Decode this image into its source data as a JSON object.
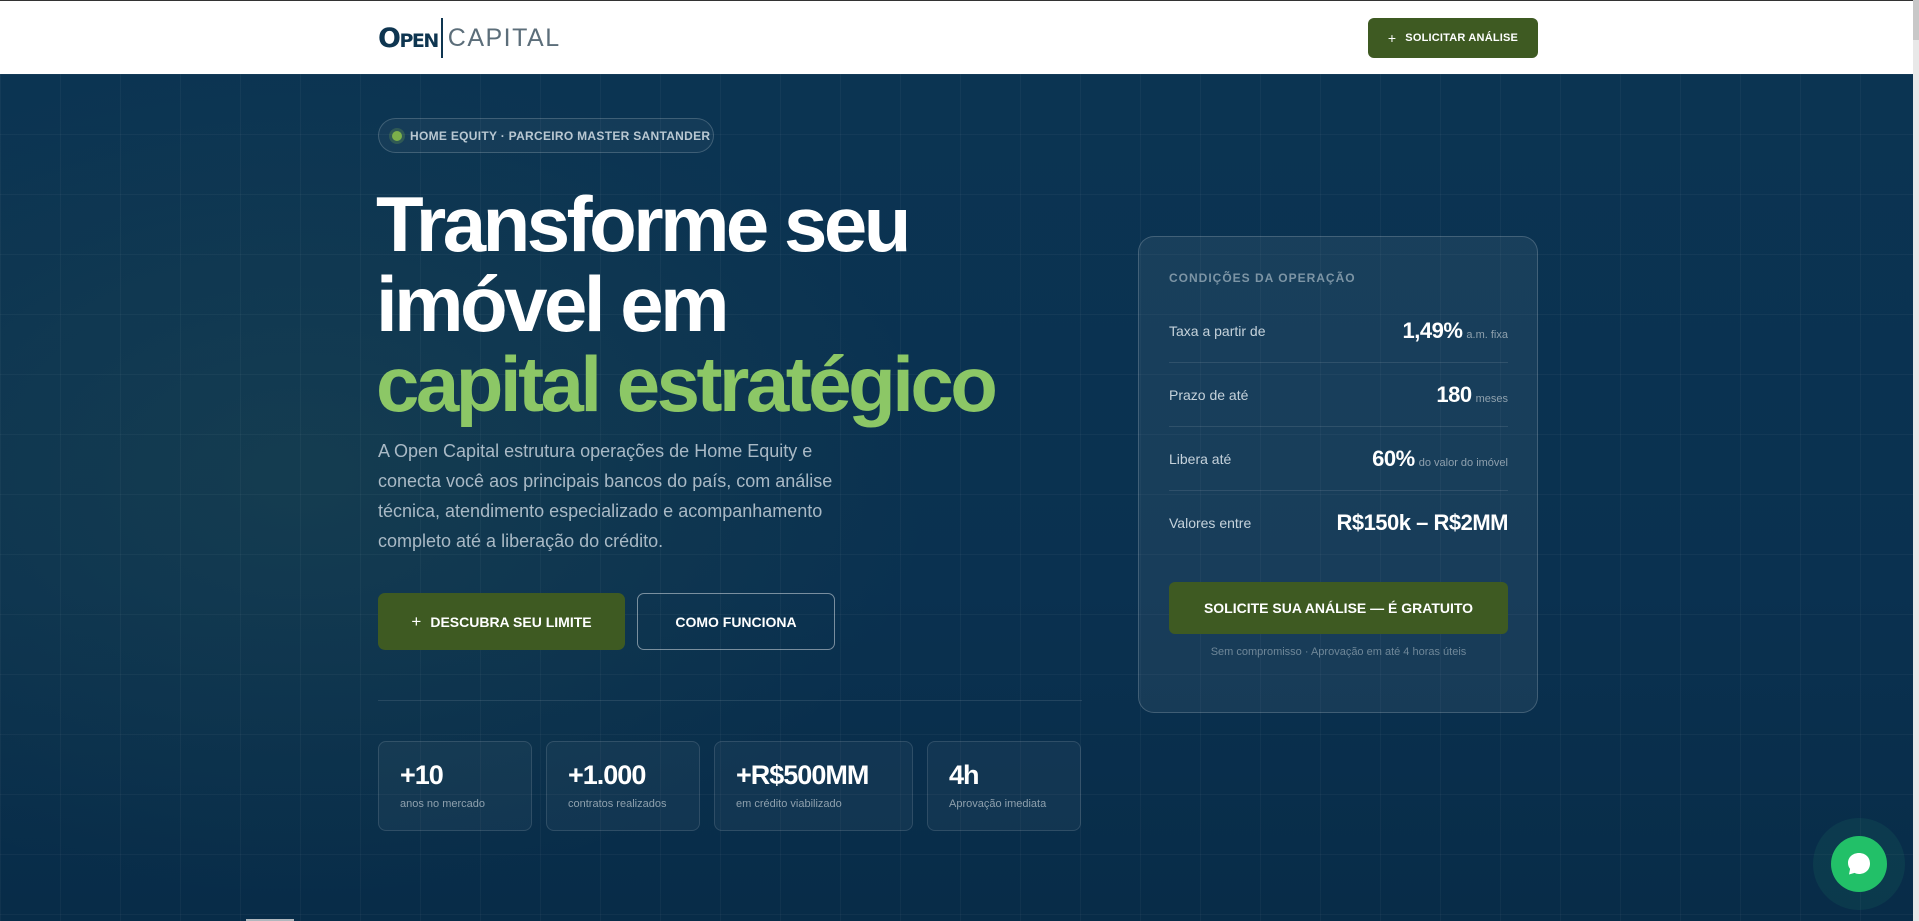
{
  "header": {
    "logo_open": "Open",
    "logo_capital": "CAPITAL",
    "cta_icon": "plus-icon",
    "cta_label": "SOLICITAR ANÁLISE"
  },
  "hero": {
    "badge": "HOME EQUITY · PARCEIRO MASTER SANTANDER",
    "title_line1": "Transforme seu",
    "title_line2": "imóvel em",
    "title_line3": "capital estratégico",
    "description": "A Open Capital estrutura operações de Home Equity e conecta você aos principais bancos do país, com análise técnica, atendimento especializado e acompanhamento completo até a liberação do crédito.",
    "primary_button": "DESCUBRA SEU LIMITE",
    "secondary_button": "COMO FUNCIONA"
  },
  "stats": [
    {
      "value": "+10",
      "label": "anos no mercado"
    },
    {
      "value": "+1.000",
      "label": "contratos realizados"
    },
    {
      "value": "+R$500MM",
      "label": "em crédito viabilizado"
    },
    {
      "value": "4h",
      "label": "Aprovação imediata"
    }
  ],
  "conditions": {
    "title": "CONDIÇÕES DA OPERAÇÃO",
    "rows": [
      {
        "label": "Taxa a partir de",
        "value": "1,49%",
        "unit": "a.m. fixa"
      },
      {
        "label": "Prazo de até",
        "value": "180",
        "unit": "meses"
      },
      {
        "label": "Libera até",
        "value": "60%",
        "unit": "do valor do imóvel"
      },
      {
        "label": "Valores entre",
        "value": "R$150k – R$2MM",
        "unit": ""
      }
    ],
    "button": "SOLICITE SUA ANÁLISE — É GRATUITO",
    "note": "Sem compromisso · Aprovação em até 4 horas úteis"
  },
  "chat": {
    "icon": "chat-bubble-icon"
  },
  "colors": {
    "brand_green": "#3e5a22",
    "accent_green": "#8cc766",
    "navy": "#0a3150",
    "whatsapp": "#22c068"
  }
}
